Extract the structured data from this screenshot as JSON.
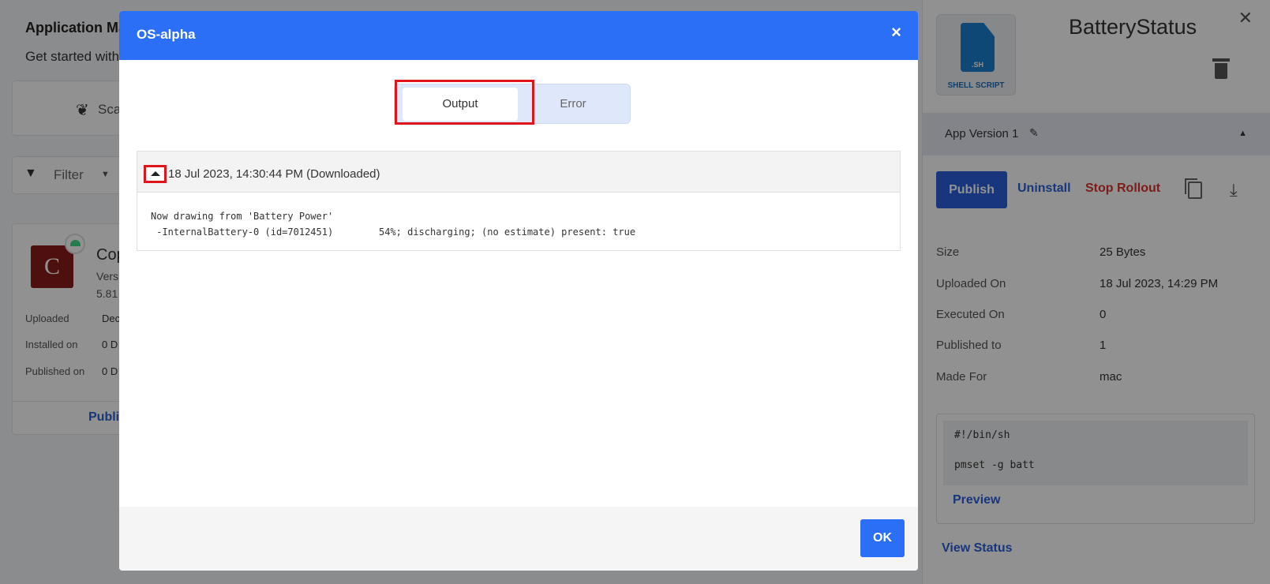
{
  "background": {
    "title": "Application Ma",
    "subtitle": "Get started with",
    "scan_label": "Sca",
    "filter_label": "Filter",
    "app_card": {
      "icon_letter": "C",
      "name": "Cop",
      "version_label": "Vers",
      "version_value": "5.81",
      "rows": [
        {
          "label": "Uploaded",
          "value": "Dec"
        },
        {
          "label": "Installed on",
          "value": "0 D"
        },
        {
          "label": "Published on",
          "value": "0 D"
        }
      ],
      "action_label": "Publi"
    }
  },
  "right_panel": {
    "app_title": "BatteryStatus",
    "icon_ext": ".SH",
    "icon_caption": "SHELL SCRIPT",
    "version_label": "App Version 1",
    "actions": {
      "publish": "Publish",
      "uninstall": "Uninstall",
      "stop_rollout": "Stop Rollout"
    },
    "properties": [
      {
        "label": "Size",
        "value": "25 Bytes"
      },
      {
        "label": "Uploaded On",
        "value": "18 Jul 2023, 14:29 PM"
      },
      {
        "label": "Executed On",
        "value": "0"
      },
      {
        "label": "Published to",
        "value": "1"
      },
      {
        "label": "Made For",
        "value": "mac"
      }
    ],
    "script_lines": [
      "#!/bin/sh",
      "pmset -g batt"
    ],
    "preview_label": "Preview",
    "view_status_label": "View Status"
  },
  "modal": {
    "title": "OS-alpha",
    "close_glyph": "×",
    "tabs": [
      {
        "label": "Output",
        "active": true
      },
      {
        "label": "Error",
        "active": false
      }
    ],
    "log": {
      "timestamp": "18 Jul 2023, 14:30:44 PM (Downloaded)",
      "output": "Now drawing from 'Battery Power'\n -InternalBattery-0 (id=7012451)\t54%; discharging; (no estimate) present: true"
    },
    "ok_label": "OK"
  },
  "colors": {
    "primary": "#2b6ff6",
    "publish": "#2b5fd9",
    "danger": "#d9342b",
    "highlight": "#e0151c"
  }
}
